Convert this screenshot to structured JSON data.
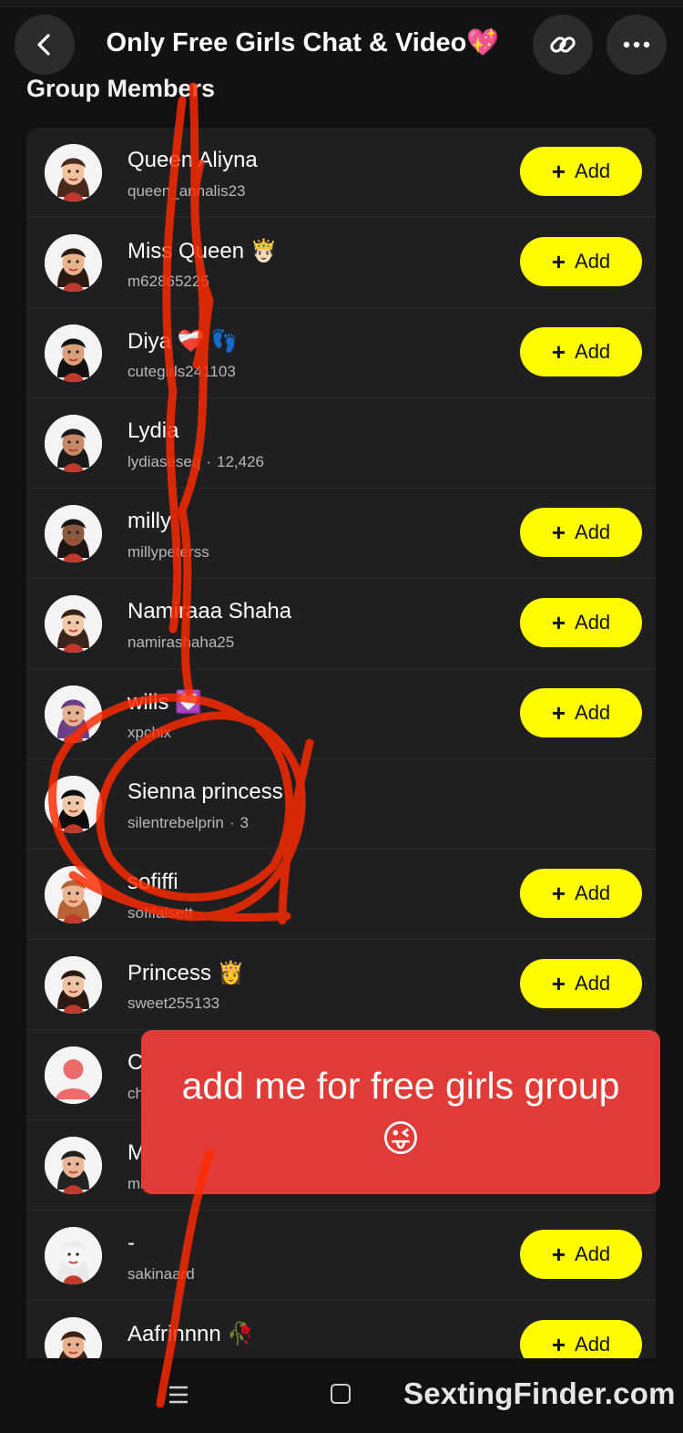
{
  "header": {
    "title": "Only Free Girls Chat & Video💖",
    "back_icon": "chevron-left-icon",
    "link_icon": "link-icon",
    "more_icon": "more-horizontal-icon"
  },
  "section_title": "Group Members",
  "add_label": "Add",
  "members": [
    {
      "name": "Queen Aliyna",
      "username": "queen_annalis23",
      "meta": "",
      "add": true
    },
    {
      "name": "Miss Queen 🤴🏻",
      "username": "m62865225",
      "meta": "",
      "add": true
    },
    {
      "name": "Diya ❤️‍🩹 👣",
      "username": "cutegirls241103",
      "meta": "",
      "add": true
    },
    {
      "name": "Lydia",
      "username": "lydiaseseq",
      "meta": "12,426",
      "add": false
    },
    {
      "name": "milly",
      "username": "millypeterss",
      "meta": "",
      "add": true
    },
    {
      "name": "Namiraaa Shaha",
      "username": "namirashaha25",
      "meta": "",
      "add": true
    },
    {
      "name": "wills 💟",
      "username": "xpchix",
      "meta": "",
      "add": true
    },
    {
      "name": "Sienna princess",
      "username": "silentrebelprin",
      "meta": "3",
      "add": false
    },
    {
      "name": "sofiffi",
      "username": "sofifalsett",
      "meta": "",
      "add": true
    },
    {
      "name": "Princess 👸",
      "username": "sweet255133",
      "meta": "",
      "add": true
    },
    {
      "name": "C",
      "username": "ch",
      "meta": "",
      "add": false
    },
    {
      "name": "M",
      "username": "ma",
      "meta": "",
      "add": false
    },
    {
      "name": "-",
      "username": "sakinaard",
      "meta": "",
      "add": true
    },
    {
      "name": "Aafrinnnn 🥀",
      "username": "",
      "meta": "",
      "add": true
    }
  ],
  "promo_text": "add me for free girls group 😜",
  "watermark": "SextingFinder.com",
  "colors": {
    "background": "#111112",
    "card": "#1f1f21",
    "add_button": "#fffc00",
    "promo": "#e03b37",
    "annotation": "#ff2a00"
  }
}
